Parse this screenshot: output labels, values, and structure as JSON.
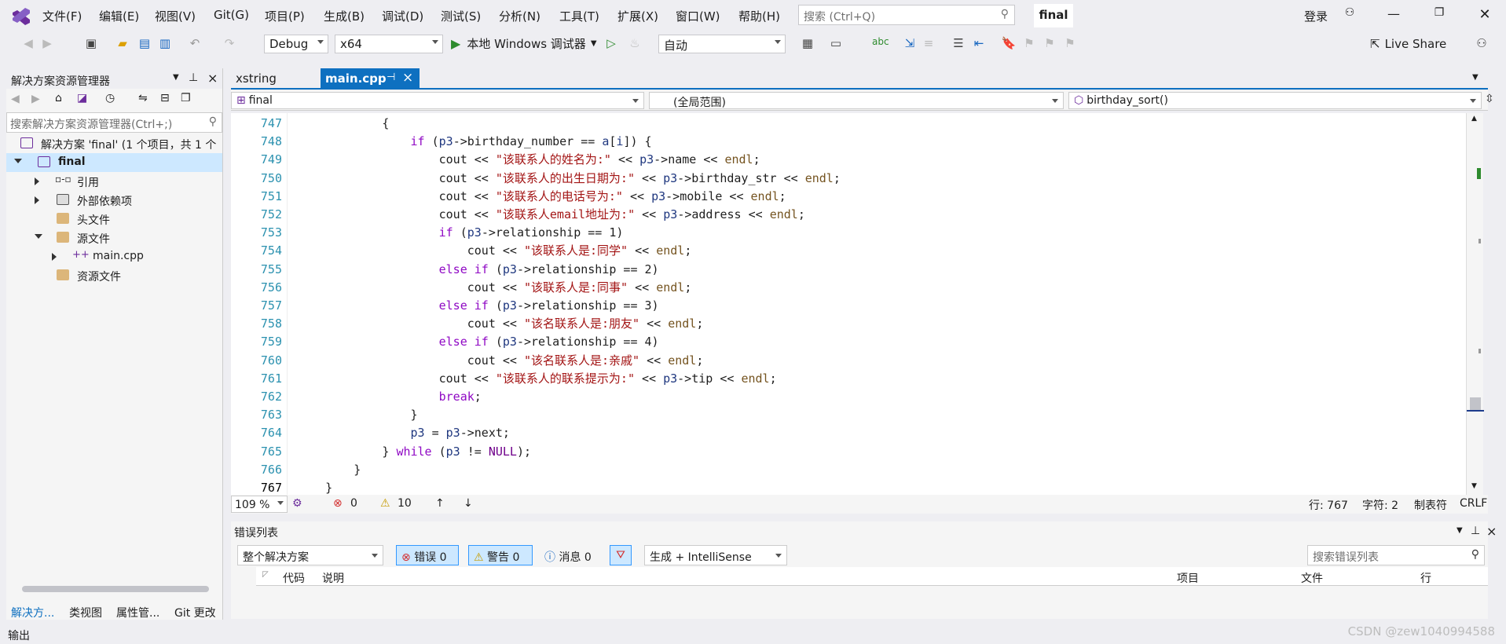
{
  "menu": [
    "文件(F)",
    "编辑(E)",
    "视图(V)",
    "Git(G)",
    "项目(P)",
    "生成(B)",
    "调试(D)",
    "测试(S)",
    "分析(N)",
    "工具(T)",
    "扩展(X)",
    "窗口(W)",
    "帮助(H)"
  ],
  "search": {
    "placeholder": "搜索 (Ctrl+Q)"
  },
  "solution_name": "final",
  "login": "登录",
  "toolbar": {
    "config": "Debug",
    "platform": "x64",
    "run_label": "本地 Windows 调试器",
    "auto": "自动",
    "live_share": "Live Share"
  },
  "solution_explorer": {
    "title": "解决方案资源管理器",
    "search_placeholder": "搜索解决方案资源管理器(Ctrl+;)",
    "tree": {
      "solution": "解决方案 'final' (1 个项目，共 1 个",
      "project": "final",
      "refs": "引用",
      "ext_deps": "外部依赖项",
      "headers": "头文件",
      "sources": "源文件",
      "main": "main.cpp",
      "resources": "资源文件"
    },
    "tabs": [
      "解决方...",
      "类视图",
      "属性管...",
      "Git 更改"
    ]
  },
  "editor": {
    "tabs": [
      {
        "label": "xstring"
      },
      {
        "label": "main.cpp",
        "pin": "⊣",
        "close": "×"
      }
    ],
    "nav": {
      "project": "final",
      "scope": "(全局范围)",
      "member": "birthday_sort()"
    }
  },
  "code_lines": [
    {
      "n": "747",
      "indent": 0,
      "t": [
        [
          "",
          "            {"
        ]
      ]
    },
    {
      "n": "748",
      "t": [
        [
          "",
          "                "
        ],
        [
          "kp",
          "if"
        ],
        [
          "",
          " ("
        ],
        [
          "vr",
          "p3"
        ],
        [
          "",
          "->birthday_number == "
        ],
        [
          "vr",
          "a"
        ],
        [
          "",
          "["
        ],
        [
          "vr",
          "i"
        ],
        [
          "",
          "]) {"
        ]
      ]
    },
    {
      "n": "749",
      "t": [
        [
          "",
          "                    cout << "
        ],
        [
          "st",
          "\"该联系人的姓名为:\""
        ],
        [
          "",
          " << "
        ],
        [
          "vr",
          "p3"
        ],
        [
          "",
          "->name << "
        ],
        [
          "fn",
          "endl"
        ],
        [
          "",
          ";"
        ]
      ]
    },
    {
      "n": "750",
      "t": [
        [
          "",
          "                    cout << "
        ],
        [
          "st",
          "\"该联系人的出生日期为:\""
        ],
        [
          "",
          " << "
        ],
        [
          "vr",
          "p3"
        ],
        [
          "",
          "->birthday_str << "
        ],
        [
          "fn",
          "endl"
        ],
        [
          "",
          ";"
        ]
      ]
    },
    {
      "n": "751",
      "t": [
        [
          "",
          "                    cout << "
        ],
        [
          "st",
          "\"该联系人的电话号为:\""
        ],
        [
          "",
          " << "
        ],
        [
          "vr",
          "p3"
        ],
        [
          "",
          "->mobile << "
        ],
        [
          "fn",
          "endl"
        ],
        [
          "",
          ";"
        ]
      ]
    },
    {
      "n": "752",
      "t": [
        [
          "",
          "                    cout << "
        ],
        [
          "st",
          "\"该联系人email地址为:\""
        ],
        [
          "",
          " << "
        ],
        [
          "vr",
          "p3"
        ],
        [
          "",
          "->address << "
        ],
        [
          "fn",
          "endl"
        ],
        [
          "",
          ";"
        ]
      ]
    },
    {
      "n": "753",
      "t": [
        [
          "",
          "                    "
        ],
        [
          "kp",
          "if"
        ],
        [
          "",
          " ("
        ],
        [
          "vr",
          "p3"
        ],
        [
          "",
          "->relationship == 1)"
        ]
      ]
    },
    {
      "n": "754",
      "t": [
        [
          "",
          "                        cout << "
        ],
        [
          "st",
          "\"该联系人是:同学\""
        ],
        [
          "",
          " << "
        ],
        [
          "fn",
          "endl"
        ],
        [
          "",
          ";"
        ]
      ]
    },
    {
      "n": "755",
      "t": [
        [
          "",
          "                    "
        ],
        [
          "kp",
          "else if"
        ],
        [
          "",
          " ("
        ],
        [
          "vr",
          "p3"
        ],
        [
          "",
          "->relationship == 2)"
        ]
      ]
    },
    {
      "n": "756",
      "t": [
        [
          "",
          "                        cout << "
        ],
        [
          "st",
          "\"该联系人是:同事\""
        ],
        [
          "",
          " << "
        ],
        [
          "fn",
          "endl"
        ],
        [
          "",
          ";"
        ]
      ]
    },
    {
      "n": "757",
      "t": [
        [
          "",
          "                    "
        ],
        [
          "kp",
          "else if"
        ],
        [
          "",
          " ("
        ],
        [
          "vr",
          "p3"
        ],
        [
          "",
          "->relationship == 3)"
        ]
      ]
    },
    {
      "n": "758",
      "t": [
        [
          "",
          "                        cout << "
        ],
        [
          "st",
          "\"该名联系人是:朋友\""
        ],
        [
          "",
          " << "
        ],
        [
          "fn",
          "endl"
        ],
        [
          "",
          ";"
        ]
      ]
    },
    {
      "n": "759",
      "t": [
        [
          "",
          "                    "
        ],
        [
          "kp",
          "else if"
        ],
        [
          "",
          " ("
        ],
        [
          "vr",
          "p3"
        ],
        [
          "",
          "->relationship == 4)"
        ]
      ]
    },
    {
      "n": "760",
      "t": [
        [
          "",
          "                        cout << "
        ],
        [
          "st",
          "\"该名联系人是:亲戚\""
        ],
        [
          "",
          " << "
        ],
        [
          "fn",
          "endl"
        ],
        [
          "",
          ";"
        ]
      ]
    },
    {
      "n": "761",
      "t": [
        [
          "",
          "                    cout << "
        ],
        [
          "st",
          "\"该联系人的联系提示为:\""
        ],
        [
          "",
          " << "
        ],
        [
          "vr",
          "p3"
        ],
        [
          "",
          "->tip << "
        ],
        [
          "fn",
          "endl"
        ],
        [
          "",
          ";"
        ]
      ]
    },
    {
      "n": "762",
      "t": [
        [
          "",
          "                    "
        ],
        [
          "kp",
          "break"
        ],
        [
          "",
          ";"
        ]
      ]
    },
    {
      "n": "763",
      "t": [
        [
          "",
          "                }"
        ]
      ]
    },
    {
      "n": "764",
      "t": [
        [
          "",
          "                "
        ],
        [
          "vr",
          "p3"
        ],
        [
          "",
          " = "
        ],
        [
          "vr",
          "p3"
        ],
        [
          "",
          "->next;"
        ]
      ]
    },
    {
      "n": "765",
      "t": [
        [
          "",
          "            } "
        ],
        [
          "kp",
          "while"
        ],
        [
          "",
          " ("
        ],
        [
          "vr",
          "p3"
        ],
        [
          "",
          " != "
        ],
        [
          "mc",
          "NULL"
        ],
        [
          "",
          ");"
        ]
      ]
    },
    {
      "n": "766",
      "t": [
        [
          "",
          "        }"
        ]
      ]
    },
    {
      "n": "767",
      "t": [
        [
          "",
          "    }"
        ]
      ]
    }
  ],
  "status": {
    "zoom": "109 %",
    "errors": "0",
    "warnings": "10",
    "line": "行: 767",
    "char": "字符: 2",
    "tabs": "制表符",
    "eol": "CRLF"
  },
  "error_list": {
    "title": "错误列表",
    "scope": "整个解决方案",
    "errors_btn": "错误 0",
    "warnings_btn": "警告 0",
    "messages_btn": "消息 0",
    "build_filter": "生成 + IntelliSense",
    "search_placeholder": "搜索错误列表",
    "columns": [
      "代码",
      "说明",
      "项目",
      "文件",
      "行"
    ]
  },
  "output_title": "输出",
  "watermark": "CSDN @zew1040994588"
}
